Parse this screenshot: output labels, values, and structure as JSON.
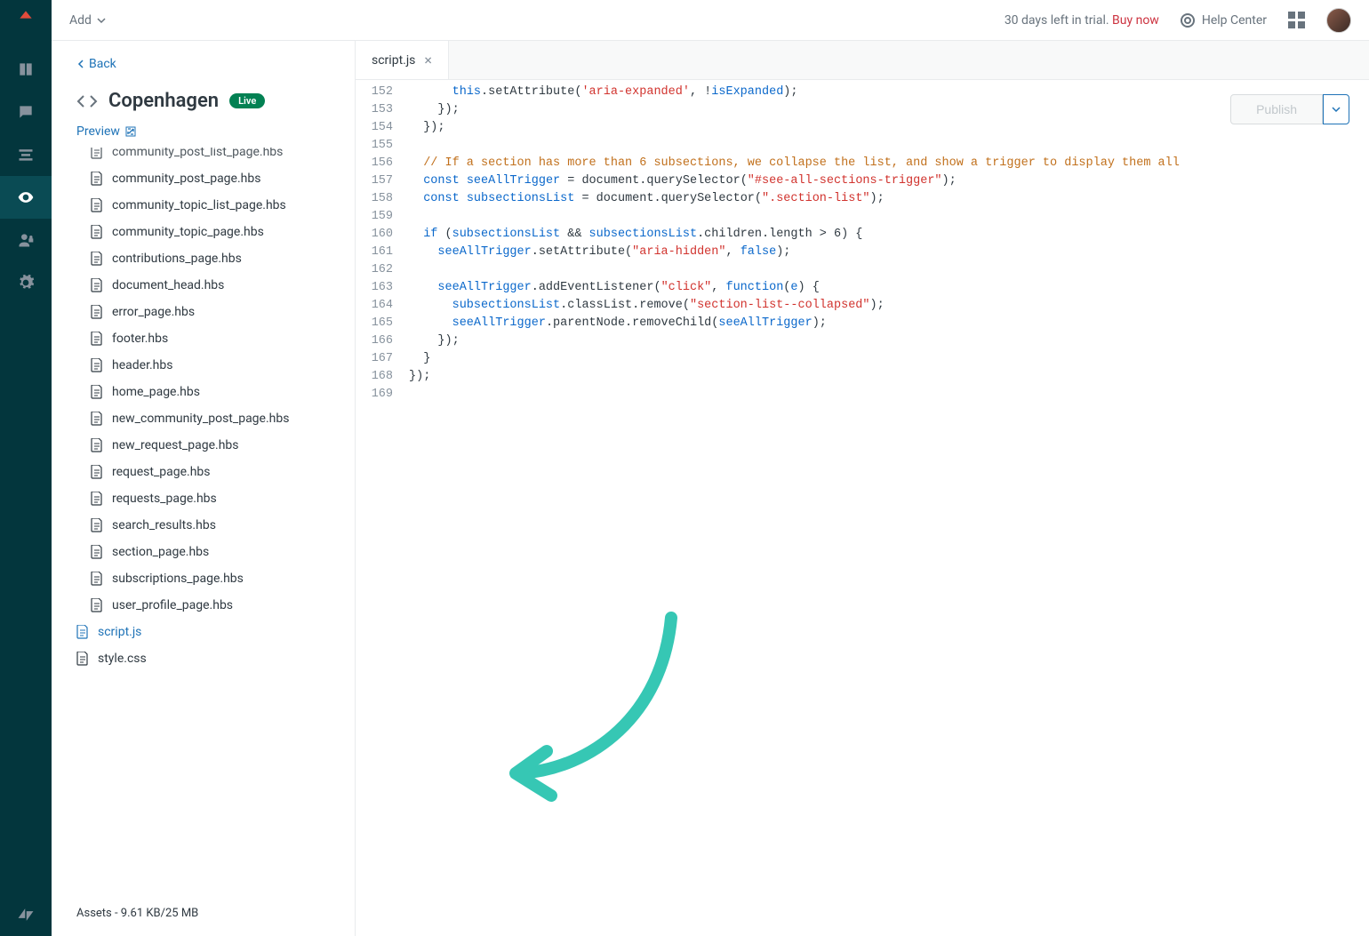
{
  "topbar": {
    "add_label": "Add",
    "trial_text": "30 days left in trial.",
    "buy_label": "Buy now",
    "help_label": "Help Center"
  },
  "sidebar": {
    "back_label": "Back",
    "theme_title": "Copenhagen",
    "live_badge": "Live",
    "preview_label": "Preview",
    "assets_footer": "Assets - 9.61 KB/25 MB",
    "files": [
      {
        "name": "community_post_list_page.hbs",
        "nested": true
      },
      {
        "name": "community_post_page.hbs",
        "nested": true
      },
      {
        "name": "community_topic_list_page.hbs",
        "nested": true
      },
      {
        "name": "community_topic_page.hbs",
        "nested": true
      },
      {
        "name": "contributions_page.hbs",
        "nested": true
      },
      {
        "name": "document_head.hbs",
        "nested": true
      },
      {
        "name": "error_page.hbs",
        "nested": true
      },
      {
        "name": "footer.hbs",
        "nested": true
      },
      {
        "name": "header.hbs",
        "nested": true
      },
      {
        "name": "home_page.hbs",
        "nested": true
      },
      {
        "name": "new_community_post_page.hbs",
        "nested": true
      },
      {
        "name": "new_request_page.hbs",
        "nested": true
      },
      {
        "name": "request_page.hbs",
        "nested": true
      },
      {
        "name": "requests_page.hbs",
        "nested": true
      },
      {
        "name": "search_results.hbs",
        "nested": true
      },
      {
        "name": "section_page.hbs",
        "nested": true
      },
      {
        "name": "subscriptions_page.hbs",
        "nested": true
      },
      {
        "name": "user_profile_page.hbs",
        "nested": true
      },
      {
        "name": "script.js",
        "nested": false,
        "active": true
      },
      {
        "name": "style.css",
        "nested": false
      }
    ]
  },
  "editor": {
    "tab_label": "script.js",
    "publish_label": "Publish",
    "line_start": 152,
    "line_end": 169,
    "code_lines": [
      {
        "n": 152,
        "html": "      <span class='tok-this'>this</span>.setAttribute(<span class='tok-str'>'aria-expanded'</span>, !<span class='tok-id'>isExpanded</span>);"
      },
      {
        "n": 153,
        "html": "    });"
      },
      {
        "n": 154,
        "html": "  });"
      },
      {
        "n": 155,
        "html": ""
      },
      {
        "n": 156,
        "html": "  <span class='tok-comment'>// If a section has more than 6 subsections, we collapse the list, and show a trigger to display them all</span>"
      },
      {
        "n": 157,
        "html": "  <span class='tok-kw'>const</span> <span class='tok-id'>seeAllTrigger</span> = document.querySelector(<span class='tok-str'>\"#see-all-sections-trigger\"</span>);"
      },
      {
        "n": 158,
        "html": "  <span class='tok-kw'>const</span> <span class='tok-id'>subsectionsList</span> = document.querySelector(<span class='tok-str'>\".section-list\"</span>);"
      },
      {
        "n": 159,
        "html": ""
      },
      {
        "n": 160,
        "html": "  <span class='tok-kw'>if</span> (<span class='tok-id'>subsectionsList</span> &amp;&amp; <span class='tok-id'>subsectionsList</span>.children.length &gt; 6) {"
      },
      {
        "n": 161,
        "html": "    <span class='tok-id'>seeAllTrigger</span>.setAttribute(<span class='tok-str'>\"aria-hidden\"</span>, <span class='tok-bool'>false</span>);"
      },
      {
        "n": 162,
        "html": ""
      },
      {
        "n": 163,
        "html": "    <span class='tok-id'>seeAllTrigger</span>.addEventListener(<span class='tok-str'>\"click\"</span>, <span class='tok-kw'>function</span>(<span class='tok-id'>e</span>) {"
      },
      {
        "n": 164,
        "html": "      <span class='tok-id'>subsectionsList</span>.classList.remove(<span class='tok-str'>\"section-list--collapsed\"</span>);"
      },
      {
        "n": 165,
        "html": "      <span class='tok-id'>seeAllTrigger</span>.parentNode.removeChild(<span class='tok-id'>seeAllTrigger</span>);"
      },
      {
        "n": 166,
        "html": "    });"
      },
      {
        "n": 167,
        "html": "  }"
      },
      {
        "n": 168,
        "html": "});"
      },
      {
        "n": 169,
        "html": ""
      }
    ]
  }
}
